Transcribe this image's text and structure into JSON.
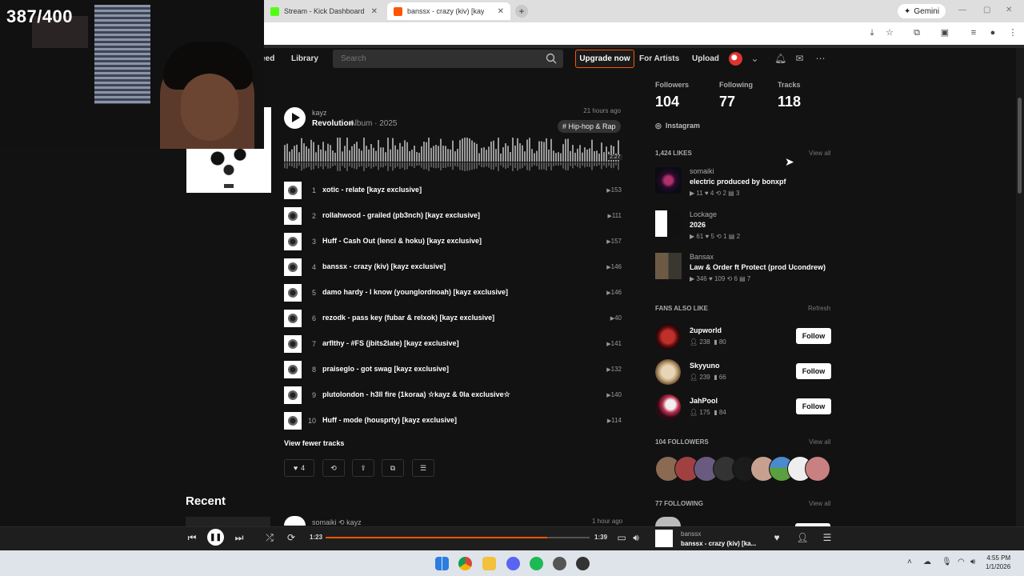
{
  "browser": {
    "tabs": [
      {
        "label": "Stream - Kick Dashboard",
        "color": "#53fc18"
      },
      {
        "label": "banssx - crazy (kiv) [kayz ex...",
        "color": "#ff5500"
      }
    ],
    "new_tab": "+",
    "gemini": "Gemini"
  },
  "webcam": {
    "counter": "387/400"
  },
  "nav": {
    "feed": "Feed",
    "library": "Library",
    "search_placeholder": "Search",
    "upgrade": "Upgrade now",
    "for_artists": "For Artists",
    "upload": "Upload"
  },
  "album": {
    "artist": "kayz",
    "title": "Revolution",
    "subtitle": "Album · 2025",
    "posted": "21 hours ago",
    "genre": "# Hip-hop & Rap",
    "duration": "2:27"
  },
  "tracks": [
    {
      "num": "1",
      "title": "xotic - relate [kayz exclusive]",
      "plays": "153"
    },
    {
      "num": "2",
      "title": "rollahwood - grailed (pb3nch) [kayz exclusive]",
      "plays": "111"
    },
    {
      "num": "3",
      "title": "Huff - Cash Out (lenci & hoku) [kayz exclusive]",
      "plays": "157"
    },
    {
      "num": "4",
      "title": "banssx - crazy (kiv) [kayz exclusive]",
      "plays": "146"
    },
    {
      "num": "5",
      "title": "damo hardy - I know (younglordnoah) [kayz exclusive]",
      "plays": "146"
    },
    {
      "num": "6",
      "title": "rezodk - pass key (fubar & relxok) [kayz exclusive]",
      "plays": "40"
    },
    {
      "num": "7",
      "title": "arflthy - #FS (jbits2late) [kayz exclusive]",
      "plays": "141"
    },
    {
      "num": "8",
      "title": "praiseglo - got swag [kayz exclusive]",
      "plays": "132"
    },
    {
      "num": "9",
      "title": "plutolondon - h3ll fire (1koraa) ☆kayz & 0la exclusive☆",
      "plays": "140"
    },
    {
      "num": "10",
      "title": "Huff - mode (housprty) [kayz exclusive]",
      "plays": "114"
    }
  ],
  "view_fewer": "View fewer tracks",
  "actions": {
    "like_count": "4"
  },
  "recent": {
    "heading": "Recent",
    "user": "somaiki",
    "reposted_by": "kayz",
    "time": "1 hour ago"
  },
  "stats": [
    {
      "label": "Followers",
      "value": "104"
    },
    {
      "label": "Following",
      "value": "77"
    },
    {
      "label": "Tracks",
      "value": "118"
    }
  ],
  "instagram": "Instagram",
  "likes": {
    "heading": "1,424 LIKES",
    "view_all": "View all",
    "items": [
      {
        "user": "somaiki",
        "title": "electric produced by bonxpf",
        "plays": "11",
        "likes": "4",
        "reposts": "2",
        "comments": "3"
      },
      {
        "user": "Lockage",
        "title": "2026",
        "plays": "61",
        "likes": "5",
        "reposts": "1",
        "comments": "2"
      },
      {
        "user": "Bansax",
        "title": "Law & Order ft Protect (prod Ucondrew)",
        "plays": "346",
        "likes": "109",
        "reposts": "6",
        "comments": "7"
      }
    ]
  },
  "fans": {
    "heading": "FANS ALSO LIKE",
    "refresh": "Refresh",
    "follow_label": "Follow",
    "items": [
      {
        "name": "2upworld",
        "followers": "238",
        "tracks": "80"
      },
      {
        "name": "Skyyuno",
        "followers": "239",
        "tracks": "66"
      },
      {
        "name": "JahPool",
        "followers": "175",
        "tracks": "84"
      }
    ]
  },
  "followers": {
    "heading": "104 FOLLOWERS",
    "view_all": "View all"
  },
  "following": {
    "heading": "77 FOLLOWING",
    "view_all": "View all"
  },
  "player": {
    "elapsed": "1:23",
    "total": "1:39",
    "progress": 0.84,
    "artist": "banssx",
    "title": "banssx - crazy (kiv) [ka..."
  },
  "taskbar": {
    "time": "4:55 PM",
    "date": "1/1/2026"
  },
  "colors": {
    "accent": "#ff5500",
    "background": "#121212"
  }
}
